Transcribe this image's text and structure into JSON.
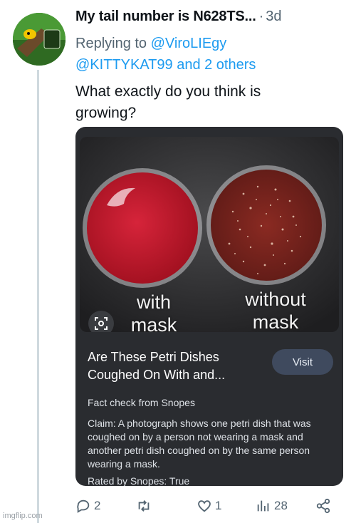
{
  "tweet": {
    "author": "My tail number is N628TS...",
    "separator": "·",
    "age": "3d",
    "replying_prefix": "Replying to",
    "mention_1": "@ViroLIEgy",
    "mention_2": "@KITTYKAT99",
    "others": "and 2 others",
    "text": "What exactly do you think is growing?"
  },
  "card": {
    "image_labels": {
      "with": "with\nmask",
      "without": "without\nmask"
    },
    "title": "Are These Petri Dishes Coughed On With and...",
    "visit_label": "Visit",
    "source": "Fact check from Snopes",
    "claim": "Claim: A photograph shows one petri dish that was coughed on by a person not wearing a mask and another petri dish coughed on by the same person wearing a mask.",
    "rating": "Rated by Snopes: True"
  },
  "actions": {
    "replies": "2",
    "retweets": "",
    "likes": "1",
    "views": "28"
  },
  "watermark": "imgflip.com",
  "colors": {
    "link": "#1d9bf0",
    "muted": "#536471",
    "card_bg": "#2a2c30",
    "dish_red": "#c91a2e"
  }
}
